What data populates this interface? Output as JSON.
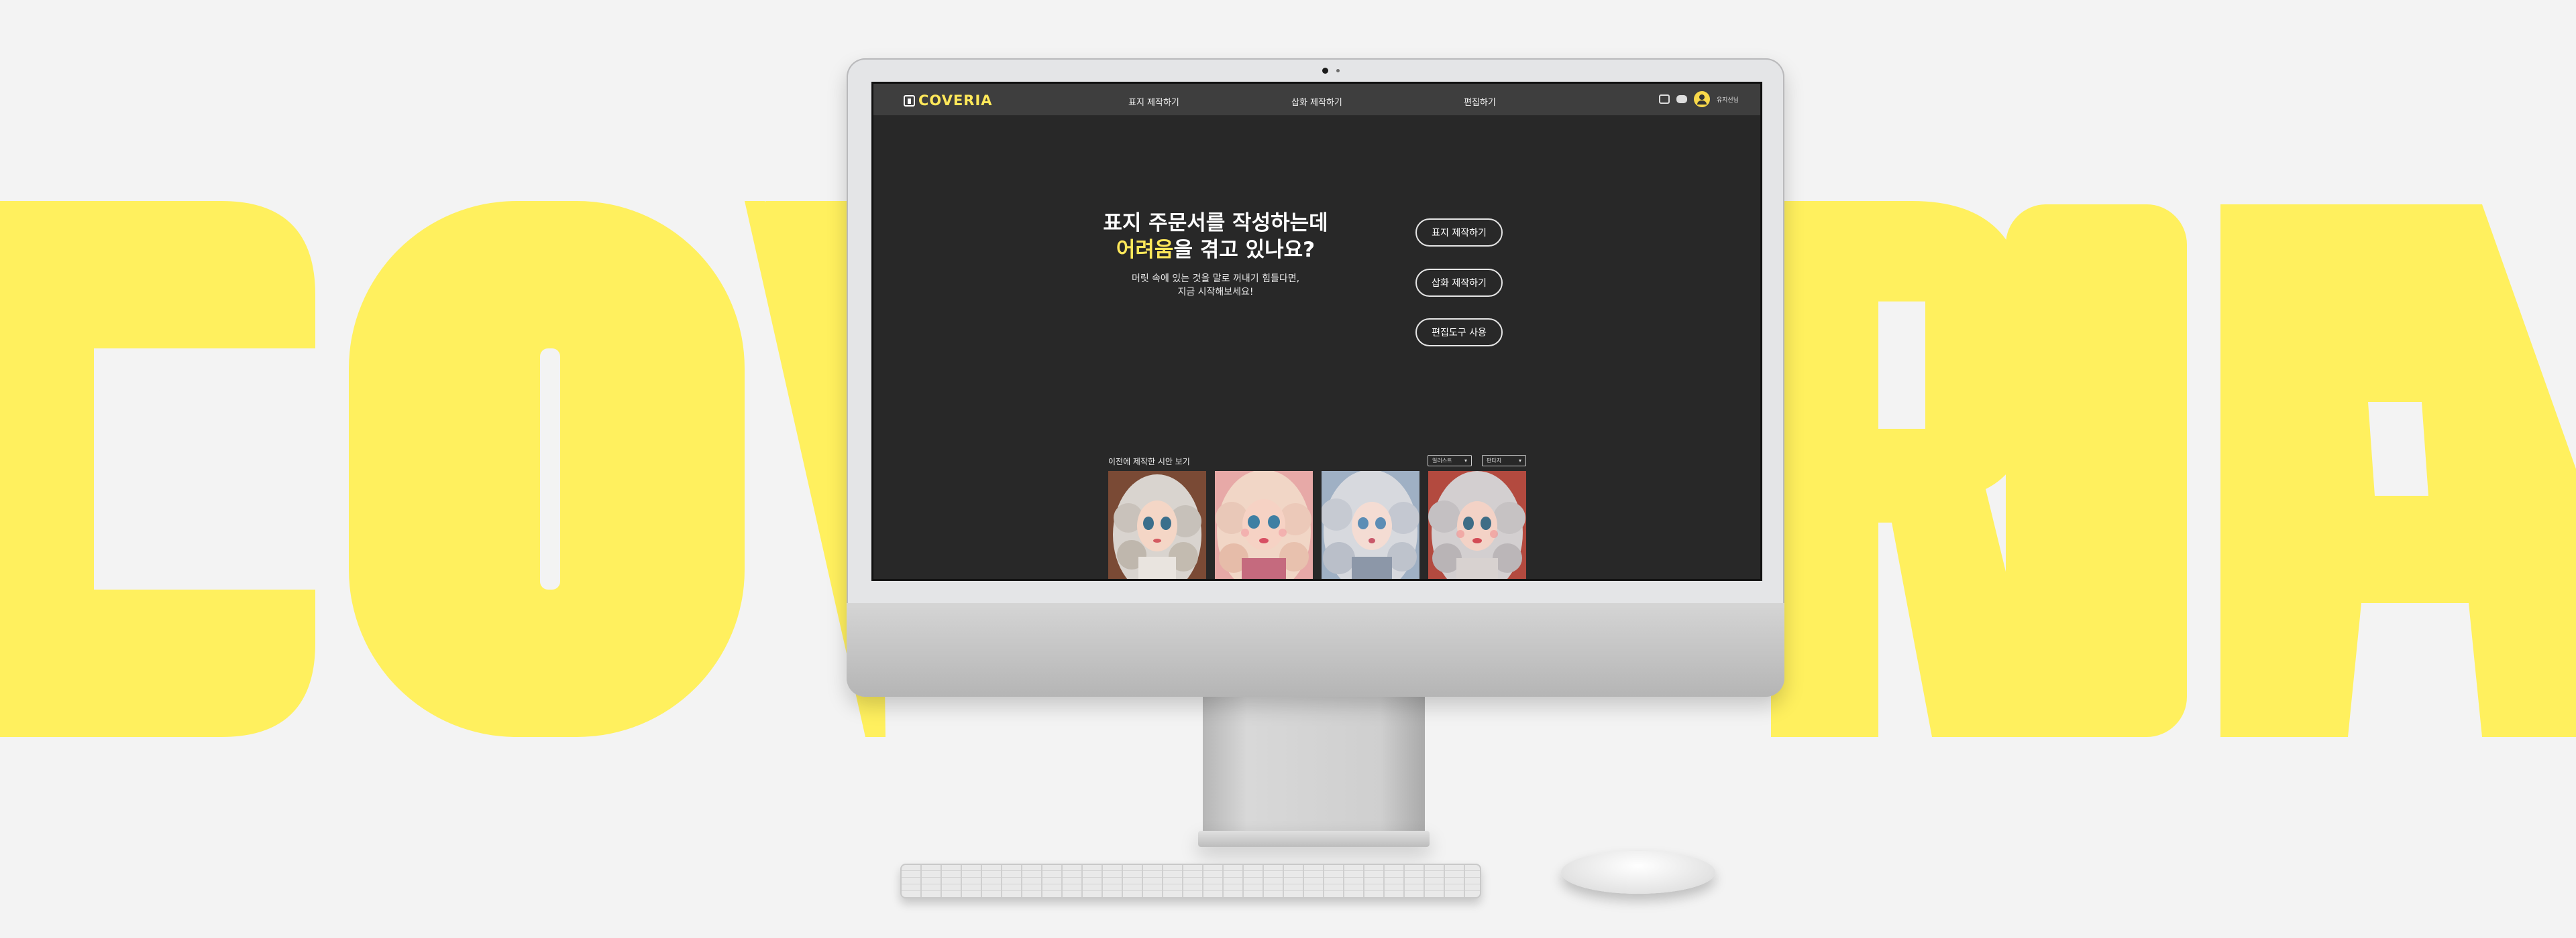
{
  "brand": {
    "name": "COVERIA",
    "accent": "#ffe85a",
    "background_wordmark": "COVERIA"
  },
  "nav": {
    "links": [
      "표지 제작하기",
      "삽화 제작하기",
      "편집하기"
    ],
    "user_name": "유지선님",
    "icons": [
      "image-icon",
      "chat-icon",
      "avatar-icon"
    ]
  },
  "hero": {
    "title_line1": "표지 주문서를 작성하는데",
    "title_highlight": "어려움",
    "title_line2_rest": "을 겪고 있나요?",
    "subtitle_line1": "머릿 속에 있는 것을 말로 꺼내기 힘들다면,",
    "subtitle_line2": "지금 시작해보세요!"
  },
  "actions": [
    "표지 제작하기",
    "삽화 제작하기",
    "편집도구 사용"
  ],
  "gallery": {
    "title": "이전에 제작한 시안 보기",
    "filters": [
      "일러스트",
      "판타지"
    ],
    "items": [
      {
        "name": "curly-silver-hair-girl-1"
      },
      {
        "name": "blonde-curly-hair-girl"
      },
      {
        "name": "silver-curly-hair-girl-2"
      },
      {
        "name": "silver-curly-hair-girl-3"
      }
    ]
  }
}
